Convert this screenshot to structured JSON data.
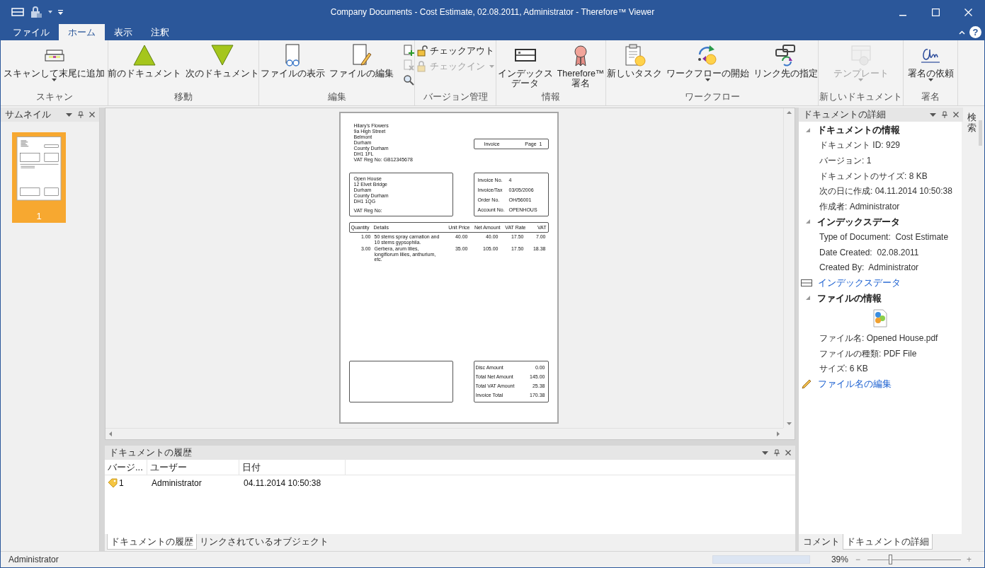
{
  "window": {
    "title": "Company Documents - Cost Estimate, 02.08.2011, Administrator - Therefore™ Viewer"
  },
  "ribbon_tabs": [
    {
      "label": "ファイル",
      "selected": false
    },
    {
      "label": "ホーム",
      "selected": true
    },
    {
      "label": "表示",
      "selected": false
    },
    {
      "label": "注釈",
      "selected": false
    }
  ],
  "help_button": "?",
  "ribbon_groups": [
    {
      "label": "スキャン",
      "buttons": [
        {
          "kind": "large",
          "lines": [
            "スキャンして末尾に追加"
          ],
          "dropdown": true,
          "disabled": false
        }
      ]
    },
    {
      "label": "移動",
      "buttons": [
        {
          "kind": "large",
          "lines": [
            "前のドキュメント"
          ],
          "dropdown": false,
          "disabled": false
        },
        {
          "kind": "large",
          "lines": [
            "次のドキュメント"
          ],
          "dropdown": false,
          "disabled": false
        }
      ]
    },
    {
      "label": "編集",
      "buttons": [
        {
          "kind": "large",
          "lines": [
            "ファイルの表示"
          ],
          "dropdown": false,
          "disabled": false
        },
        {
          "kind": "large",
          "lines": [
            "ファイルの編集"
          ],
          "dropdown": false,
          "disabled": false
        },
        {
          "kind": "icon_stack",
          "items": [
            {
              "disabled": false
            },
            {
              "disabled": true
            },
            {
              "disabled": false
            }
          ]
        }
      ]
    },
    {
      "label": "バージョン管理",
      "buttons": [
        {
          "kind": "row_stack",
          "items": [
            {
              "label": "チェックアウト",
              "disabled": false,
              "dropdown": false
            },
            {
              "label": "チェックイン",
              "disabled": true,
              "dropdown": true
            }
          ]
        }
      ]
    },
    {
      "label": "情報",
      "buttons": [
        {
          "kind": "large",
          "lines": [
            "インデックス",
            "データ"
          ],
          "dropdown": false,
          "disabled": false
        },
        {
          "kind": "large",
          "lines": [
            "Therefore™",
            "署名"
          ],
          "dropdown": false,
          "disabled": false
        }
      ]
    },
    {
      "label": "ワークフロー",
      "buttons": [
        {
          "kind": "large",
          "lines": [
            "新しいタスク"
          ],
          "dropdown": false,
          "disabled": false
        },
        {
          "kind": "large",
          "lines": [
            "ワークフローの開始"
          ],
          "dropdown": true,
          "disabled": false
        },
        {
          "kind": "large",
          "lines": [
            "リンク先の指定"
          ],
          "dropdown": false,
          "disabled": false
        }
      ]
    },
    {
      "label": "新しいドキュメント",
      "buttons": [
        {
          "kind": "large",
          "lines": [
            "テンプレート"
          ],
          "dropdown": true,
          "disabled": true
        }
      ]
    },
    {
      "label": "署名",
      "buttons": [
        {
          "kind": "large",
          "lines": [
            "署名の依頼"
          ],
          "dropdown": true,
          "disabled": false
        }
      ]
    }
  ],
  "thumbnails_panel": {
    "title": "サムネイル",
    "pages": [
      {
        "label": "1",
        "selected": true
      }
    ]
  },
  "document": {
    "sender": [
      "Hilary's Flowers",
      "9a High Street",
      "Belmont",
      "Durham",
      "County Durham",
      "DH1 1FL",
      "VAT Reg No: GB12345678"
    ],
    "invoice_box": {
      "title": "Invoice",
      "page_label": "Page",
      "page": "1"
    },
    "recipient": [
      "Open House",
      "12 Elvet Bridge",
      "Durham",
      "County Durham",
      "DH1 1QG"
    ],
    "recipient_vat": "VAT Reg No:",
    "info": [
      [
        "Invoice No.",
        "4"
      ],
      [
        "Invoice/Tax",
        "03/05/2006"
      ],
      [
        "Order No.",
        "OH/56001"
      ],
      [
        "Account No.",
        "OPENHOUS"
      ]
    ],
    "columns": [
      "Quantity",
      "Details",
      "Unit Price",
      "Net Amount",
      "VAT Rate",
      "VAT"
    ],
    "rows": [
      [
        "1.00",
        "50 stems spray carnation and 10 stems gypsophila.",
        "40.00",
        "40.00",
        "17.50",
        "7.00"
      ],
      [
        "3.00",
        "Gerbera, arum lilies, longiflorum lilies, anthurium, etc.",
        "35.00",
        "105.00",
        "17.50",
        "18.38"
      ]
    ],
    "totals": [
      [
        "Disc Amount",
        "0.00"
      ],
      [
        "Total Net Amount",
        "145.00"
      ],
      [
        "Total VAT Amount",
        "25.38"
      ],
      [
        "Invoice Total",
        "170.38"
      ]
    ]
  },
  "history_panel": {
    "title": "ドキュメントの履歴",
    "columns": [
      "バージ...",
      "ユーザー",
      "日付"
    ],
    "rows": [
      [
        "1",
        "Administrator",
        "04.11.2014 10:50:38"
      ]
    ],
    "tabs": [
      {
        "label": "ドキュメントの履歴",
        "selected": true
      },
      {
        "label": "リンクされているオブジェクト",
        "selected": false
      }
    ]
  },
  "details_panel": {
    "title": "ドキュメントの詳細",
    "entries": [
      {
        "kind": "section",
        "text": "ドキュメントの情報",
        "expanded": true
      },
      {
        "kind": "field",
        "text": "ドキュメント ID: 929"
      },
      {
        "kind": "field",
        "text": "バージョン: 1"
      },
      {
        "kind": "field",
        "text": "ドキュメントのサイズ: 8 KB"
      },
      {
        "kind": "field",
        "text": "次の日に作成: 04.11.2014 10:50:38"
      },
      {
        "kind": "field",
        "text": "作成者: Administrator"
      },
      {
        "kind": "section",
        "text": "インデックスデータ",
        "expanded": true
      },
      {
        "kind": "field",
        "text": "Type of Document:  Cost Estimate"
      },
      {
        "kind": "field",
        "text": "Date Created:  02.08.2011"
      },
      {
        "kind": "field",
        "text": "Created By:  Administrator"
      },
      {
        "kind": "link",
        "text": "インデックスデータ"
      },
      {
        "kind": "section",
        "text": "ファイルの情報",
        "expanded": true
      },
      {
        "kind": "file_icon"
      },
      {
        "kind": "field",
        "text": "ファイル名: Opened House.pdf"
      },
      {
        "kind": "field",
        "text": "ファイルの種類: PDF File"
      },
      {
        "kind": "field",
        "text": "サイズ: 6 KB"
      },
      {
        "kind": "link",
        "text": "ファイル名の編集"
      }
    ],
    "tabs": [
      {
        "label": "コメント",
        "selected": false
      },
      {
        "label": "ドキュメントの詳細",
        "selected": true
      }
    ]
  },
  "side_tab": "検索",
  "status_bar": {
    "user": "Administrator",
    "progress_bar": {
      "level": 1
    },
    "zoom": "39%",
    "zoom_minus": "−",
    "zoom_plus": "+",
    "zoom_slider": {
      "level": 0.24
    }
  }
}
